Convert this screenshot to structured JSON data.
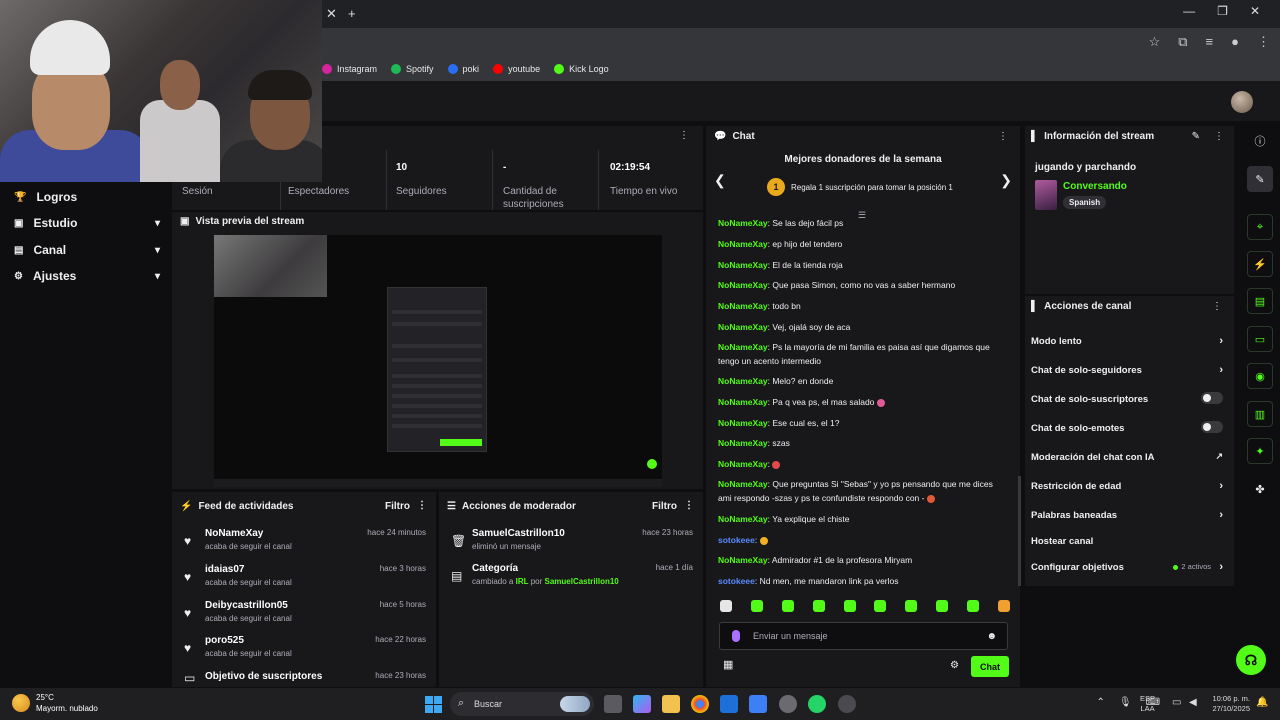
{
  "browser": {
    "bookmarks": [
      {
        "label": "Instagram",
        "color": "#d6249f"
      },
      {
        "label": "Spotify",
        "color": "#1db954"
      },
      {
        "label": "poki",
        "color": "#2a6ef5"
      },
      {
        "label": "youtube",
        "color": "#ff0000"
      },
      {
        "label": "Kick Logo",
        "color": "#53fc18"
      }
    ]
  },
  "nav": {
    "items": [
      {
        "label": "Logros",
        "icon": "trophy-icon",
        "has_chevron": false
      },
      {
        "label": "Estudio",
        "icon": "studio-icon",
        "has_chevron": true
      },
      {
        "label": "Canal",
        "icon": "channel-icon",
        "has_chevron": true
      },
      {
        "label": "Ajustes",
        "icon": "settings-icon",
        "has_chevron": true
      }
    ]
  },
  "stats": {
    "session_label": "Sesión",
    "viewers_label": "Espectadores",
    "followers_value": "10",
    "followers_label": "Seguidores",
    "subs_value": "-",
    "subs_label": "Cantidad de suscripciones",
    "uptime_value": "02:19:54",
    "uptime_label": "Tiempo en vivo"
  },
  "preview": {
    "title": "Vista previa del stream"
  },
  "activity_feed": {
    "title": "Feed de actividades",
    "filter_label": "Filtro",
    "rows": [
      {
        "name": "NoNameXay",
        "sub": "acaba de seguir el canal",
        "time": "hace 24 minutos"
      },
      {
        "name": "idaias07",
        "sub": "acaba de seguir el canal",
        "time": "hace 3 horas"
      },
      {
        "name": "Deibycastrillon05",
        "sub": "acaba de seguir el canal",
        "time": "hace 5 horas"
      },
      {
        "name": "poro525",
        "sub": "acaba de seguir el canal",
        "time": "hace 22 horas"
      },
      {
        "name": "Objetivo de suscriptores",
        "sub": "",
        "time": "hace 23 horas"
      }
    ]
  },
  "mod_actions": {
    "title": "Acciones de moderador",
    "filter_label": "Filtro",
    "rows": [
      {
        "name": "SamuelCastrillon10",
        "sub": "eliminó un mensaje",
        "time": "hace 23 horas",
        "icon": "trash-icon"
      },
      {
        "name": "Categoría",
        "sub_prefix": "cambiado a ",
        "sub_cat": "IRL",
        "sub_mid": " por ",
        "sub_user": "SamuelCastrillon10",
        "time": "hace 1 día",
        "icon": "category-icon"
      }
    ]
  },
  "chat": {
    "title": "Chat",
    "donors_title": "Mejores donadores de la semana",
    "donors_rank": "1",
    "donors_text": "Regala 1 suscripción para tomar la posición 1",
    "messages": [
      {
        "user": "NoNameXay",
        "text": "Se las dejo fácil ps"
      },
      {
        "user": "NoNameXay",
        "text": "ep hijo del tendero"
      },
      {
        "user": "NoNameXay",
        "text": "El de la tienda roja"
      },
      {
        "user": "NoNameXay",
        "text": "Que pasa Simon, como no vas a saber hermano"
      },
      {
        "user": "NoNameXay",
        "text": "todo bn"
      },
      {
        "user": "NoNameXay",
        "text": "Vej, ojalá soy de aca"
      },
      {
        "user": "NoNameXay",
        "text": "Ps la mayoría de mi familia es paisa así que digamos que tengo un acento intermedio"
      },
      {
        "user": "NoNameXay",
        "text": "Melo? en donde"
      },
      {
        "user": "NoNameXay",
        "text": "Pa q vea ps, el mas salado"
      },
      {
        "user": "NoNameXay",
        "text": "Ese cual es, el 1?"
      },
      {
        "user": "NoNameXay",
        "text": "szas"
      },
      {
        "user": "NoNameXay",
        "text": ""
      },
      {
        "user": "NoNameXay",
        "text": "Que preguntas Si \"Sebas\" y yo ps pensando que me dices ami respondo -szas y ps te confundiste respondo con -"
      },
      {
        "user": "NoNameXay",
        "text": "Ya explique el chiste"
      },
      {
        "user": "sotokeee",
        "text": ""
      },
      {
        "user": "NoNameXay",
        "text": "Admirador #1 de la profesora Miryam"
      },
      {
        "user": "sotokeee",
        "text": "Nd men, me mandaron link pa verlos"
      }
    ],
    "input_placeholder": "Enviar un mensaje",
    "send_label": "Chat"
  },
  "stream_info": {
    "title": "Información del stream",
    "stream_title": "jugando y parchando",
    "category": "Conversando",
    "language": "Spanish"
  },
  "channel_actions": {
    "title": "Acciones de canal",
    "items": [
      {
        "label": "Modo lento",
        "control": "chevron"
      },
      {
        "label": "Chat de solo-seguidores",
        "control": "chevron"
      },
      {
        "label": "Chat de solo-suscriptores",
        "control": "toggle"
      },
      {
        "label": "Chat de solo-emotes",
        "control": "toggle"
      },
      {
        "label": "Moderación del chat con IA",
        "control": "external"
      },
      {
        "label": "Restricción de edad",
        "control": "chevron"
      },
      {
        "label": "Palabras baneadas",
        "control": "chevron"
      },
      {
        "label": "Hostear canal",
        "control": "none"
      },
      {
        "label": "Configurar objetivos",
        "control": "chevron",
        "badge": "2 activos"
      }
    ]
  },
  "taskbar": {
    "temp": "25°C",
    "weather": "Mayorm. nublado",
    "search_label": "Buscar",
    "lang_top": "ESP",
    "lang_bottom": "LAA",
    "time": "10:06 p. m.",
    "date": "27/10/2025"
  },
  "colors": {
    "accent": "#53fc18",
    "panel": "#18181b",
    "background": "#0e0e10"
  }
}
